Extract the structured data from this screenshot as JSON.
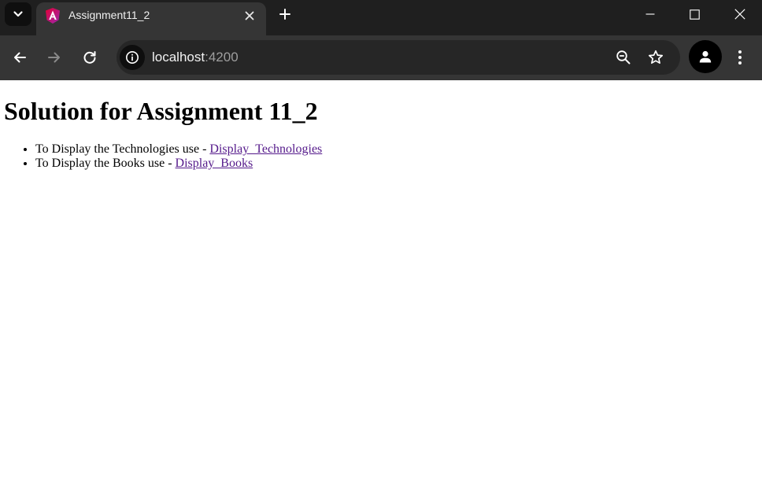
{
  "browser": {
    "tab": {
      "title": "Assignment11_2",
      "favicon": "angular-logo-icon"
    },
    "address": {
      "host": "localhost",
      "port": ":4200"
    },
    "colors": {
      "tabstrip": "#1f1f1f",
      "toolbar": "#353535",
      "omnibox": "#262626",
      "angular_pink": "#e40035",
      "angular_purple": "#9c27b0"
    }
  },
  "page": {
    "heading": "Solution for Assignment 11_2",
    "items": [
      {
        "text": "To Display the Technologies use - ",
        "link": "Display_Technologies"
      },
      {
        "text": "To Display the Books use - ",
        "link": "Display_Books"
      }
    ],
    "link_color": "#551a8b"
  }
}
